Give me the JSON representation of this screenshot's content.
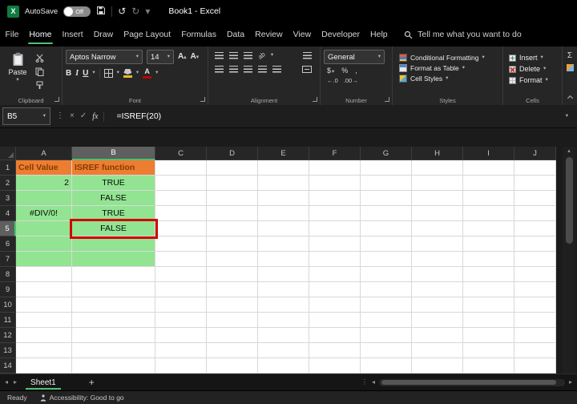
{
  "colors": {
    "accent_green": "#4CC273",
    "header_fill": "#ED7D31",
    "header_text": "#833C00",
    "range_fill": "#92E492",
    "selection_red": "#D40000"
  },
  "icons": {
    "excel_logo": "X",
    "dropdown": "▾",
    "undo": "↺",
    "redo": "↻",
    "check": "✓",
    "cancel": "×",
    "ellipsis_v": "⋮",
    "sigma": "Σ",
    "plus": "+",
    "scroll_left": "◂",
    "scroll_right": "▸",
    "scroll_up": "▴",
    "currency": "$",
    "percent": "%",
    "comma": ",",
    "decimal_increase": "←.0",
    "decimal_decrease": ".00→",
    "bold": "B",
    "italic": "I",
    "underline": "U",
    "letter_A": "A",
    "fx": "fx",
    "orientation": "ab"
  },
  "titlebar": {
    "autosave_label": "AutoSave",
    "autosave_state": "Off",
    "title": "Book1 - Excel"
  },
  "ribbon": {
    "active_tab": "Home",
    "tabs": [
      "File",
      "Home",
      "Insert",
      "Draw",
      "Page Layout",
      "Formulas",
      "Data",
      "Review",
      "View",
      "Developer",
      "Help"
    ],
    "search_text": "Tell me what you want to do",
    "clipboard": {
      "label": "Clipboard",
      "paste": "Paste"
    },
    "font": {
      "label": "Font",
      "font_name": "Aptos Narrow",
      "font_size": "14"
    },
    "alignment": {
      "label": "Alignment"
    },
    "number": {
      "label": "Number",
      "format": "General"
    },
    "styles": {
      "label": "Styles",
      "items": [
        "Conditional Formatting",
        "Format as Table",
        "Cell Styles"
      ]
    },
    "cells": {
      "label": "Cells",
      "items": [
        "Insert",
        "Delete",
        "Format"
      ]
    }
  },
  "formula_bar": {
    "name_box": "B5",
    "formula": "=ISREF(20)"
  },
  "grid": {
    "columns": [
      "A",
      "B",
      "C",
      "D",
      "E",
      "F",
      "G",
      "H",
      "I",
      "J"
    ],
    "row_count": 14,
    "selected_cell": "B5",
    "cells": [
      {
        "ref": "A1",
        "text": "Cell Value",
        "fill": "orange",
        "align": "left"
      },
      {
        "ref": "B1",
        "text": "ISREF function",
        "fill": "orange",
        "align": "left"
      },
      {
        "ref": "A2",
        "text": "2",
        "fill": "green",
        "align": "right"
      },
      {
        "ref": "B2",
        "text": "TRUE",
        "fill": "green",
        "align": "center"
      },
      {
        "ref": "A3",
        "text": "",
        "fill": "green",
        "align": "left"
      },
      {
        "ref": "B3",
        "text": "FALSE",
        "fill": "green",
        "align": "center"
      },
      {
        "ref": "A4",
        "text": "#DIV/0!",
        "fill": "green",
        "align": "center"
      },
      {
        "ref": "B4",
        "text": "TRUE",
        "fill": "green",
        "align": "center"
      },
      {
        "ref": "A5",
        "text": "",
        "fill": "green",
        "align": "left"
      },
      {
        "ref": "B5",
        "text": "FALSE",
        "fill": "green",
        "align": "center"
      },
      {
        "ref": "A6",
        "text": "",
        "fill": "green",
        "align": "left"
      },
      {
        "ref": "B6",
        "text": "",
        "fill": "green",
        "align": "left"
      },
      {
        "ref": "A7",
        "text": "",
        "fill": "green",
        "align": "left"
      },
      {
        "ref": "B7",
        "text": "",
        "fill": "green",
        "align": "left"
      }
    ]
  },
  "sheet_bar": {
    "active_sheet": "Sheet1"
  },
  "status_bar": {
    "mode": "Ready",
    "accessibility": "Accessibility: Good to go"
  }
}
